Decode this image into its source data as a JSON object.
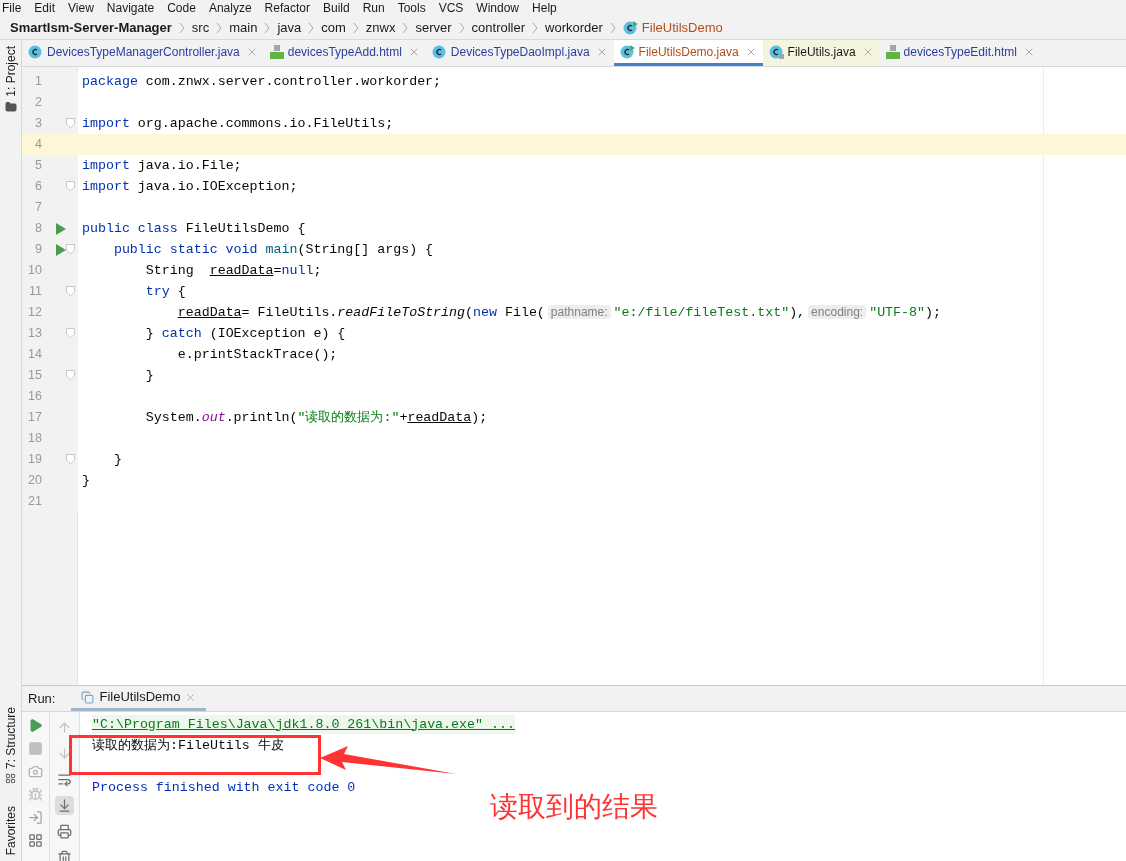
{
  "menu": [
    "File",
    "Edit",
    "View",
    "Navigate",
    "Code",
    "Analyze",
    "Refactor",
    "Build",
    "Run",
    "Tools",
    "VCS",
    "Window",
    "Help"
  ],
  "breadcrumbs": [
    {
      "label": "SmartIsm-Server-Manager",
      "kind": "project"
    },
    {
      "label": "src",
      "kind": "folder"
    },
    {
      "label": "main",
      "kind": "folder"
    },
    {
      "label": "java",
      "kind": "folder"
    },
    {
      "label": "com",
      "kind": "folder"
    },
    {
      "label": "znwx",
      "kind": "folder"
    },
    {
      "label": "server",
      "kind": "folder"
    },
    {
      "label": "controller",
      "kind": "folder"
    },
    {
      "label": "workorder",
      "kind": "folder"
    },
    {
      "label": "FileUtilsDemo",
      "kind": "class-run"
    }
  ],
  "side_tools": {
    "top": "1: Project",
    "bottom": [
      "7: Structure",
      "Favorites"
    ]
  },
  "tabs": [
    {
      "label": "DevicesTypeManagerController.java",
      "kind": "class",
      "selected": false
    },
    {
      "label": "devicesTypeAdd.html",
      "kind": "html",
      "selected": false
    },
    {
      "label": "DevicesTypeDaoImpl.java",
      "kind": "class",
      "selected": false
    },
    {
      "label": "FileUtilsDemo.java",
      "kind": "class-run",
      "selected": true
    },
    {
      "label": "FileUtils.java",
      "kind": "library",
      "selected": false
    },
    {
      "label": "devicesTypeEdit.html",
      "kind": "html",
      "selected": false
    }
  ],
  "code_lines": [
    {
      "number": "1",
      "run": false,
      "fold": false,
      "current": false,
      "tokens": [
        {
          "kind": "keyword",
          "text": "package"
        },
        {
          "kind": "plain",
          "text": " com.znwx.server.controller.workorder;"
        }
      ]
    },
    {
      "number": "2",
      "run": false,
      "fold": false,
      "current": false
    },
    {
      "number": "3",
      "run": false,
      "fold": true,
      "current": false,
      "tokens": [
        {
          "kind": "keyword",
          "text": "import"
        },
        {
          "kind": "plain",
          "text": " org.apache.commons.io.FileUtils;"
        }
      ]
    },
    {
      "number": "4",
      "run": false,
      "fold": false,
      "current": true
    },
    {
      "number": "5",
      "run": false,
      "fold": false,
      "current": false,
      "tokens": [
        {
          "kind": "keyword",
          "text": "import"
        },
        {
          "kind": "plain",
          "text": " java.io.File;"
        }
      ]
    },
    {
      "number": "6",
      "run": false,
      "fold": true,
      "current": false,
      "tokens": [
        {
          "kind": "keyword",
          "text": "import"
        },
        {
          "kind": "plain",
          "text": " java.io.IOException;"
        }
      ]
    },
    {
      "number": "7",
      "run": false,
      "fold": false,
      "current": false
    },
    {
      "number": "8",
      "run": true,
      "fold": false,
      "current": false,
      "tokens": [
        {
          "kind": "keyword",
          "text": "public class"
        },
        {
          "kind": "plain",
          "text": " FileUtilsDemo {"
        }
      ],
      "children": [
        {
          "number": "9",
          "run": true,
          "fold": true,
          "current": false,
          "tokens": [
            {
              "kind": "keyword",
              "text": "public static void"
            },
            {
              "kind": "method",
              "text": " main"
            },
            {
              "kind": "plain",
              "text": "(String[] args) {"
            }
          ],
          "children": [
            {
              "number": "10",
              "run": false,
              "fold": false,
              "current": false,
              "tokens": [
                {
                  "kind": "plain",
                  "text": "String  "
                },
                {
                  "kind": "variable",
                  "text": "readData"
                },
                {
                  "kind": "plain",
                  "text": "="
                },
                {
                  "kind": "keyword",
                  "text": "null"
                },
                {
                  "kind": "plain",
                  "text": ";"
                }
              ]
            },
            {
              "number": "11",
              "run": false,
              "fold": true,
              "current": false,
              "tokens": [
                {
                  "kind": "keyword",
                  "text": "try"
                },
                {
                  "kind": "plain",
                  "text": " {"
                }
              ],
              "children": [
                {
                  "number": "12",
                  "run": false,
                  "fold": false,
                  "current": false,
                  "tokens": [
                    {
                      "kind": "variable",
                      "text": "readData"
                    },
                    {
                      "kind": "plain",
                      "text": "= FileUtils."
                    },
                    {
                      "kind": "static-method",
                      "text": "readFileToString"
                    },
                    {
                      "kind": "plain",
                      "text": "("
                    },
                    {
                      "kind": "keyword",
                      "text": "new"
                    },
                    {
                      "kind": "plain",
                      "text": " File("
                    },
                    {
                      "kind": "hint",
                      "text": "pathname:"
                    },
                    {
                      "kind": "string",
                      "text": "\"e:/file/fileTest.txt\""
                    },
                    {
                      "kind": "plain",
                      "text": "),"
                    },
                    {
                      "kind": "hint",
                      "text": "encoding:"
                    },
                    {
                      "kind": "string",
                      "text": "\"UTF-8\""
                    },
                    {
                      "kind": "plain",
                      "text": ");"
                    }
                  ]
                }
              ]
            },
            {
              "number": "13",
              "run": false,
              "fold": true,
              "current": false,
              "tokens": [
                {
                  "kind": "plain",
                  "text": "} "
                },
                {
                  "kind": "keyword",
                  "text": "catch"
                },
                {
                  "kind": "plain",
                  "text": " (IOException e) {"
                }
              ],
              "children": [
                {
                  "number": "14",
                  "run": false,
                  "fold": false,
                  "current": false,
                  "tokens": [
                    {
                      "kind": "plain",
                      "text": "e.printStackTrace();"
                    }
                  ]
                }
              ]
            },
            {
              "number": "15",
              "run": false,
              "fold": true,
              "current": false,
              "tokens": [
                {
                  "kind": "plain",
                  "text": "}"
                }
              ]
            },
            {
              "number": "16",
              "run": false,
              "fold": false,
              "current": false
            },
            {
              "number": "17",
              "run": false,
              "fold": false,
              "current": false,
              "tokens": [
                {
                  "kind": "plain",
                  "text": "System."
                },
                {
                  "kind": "static-field",
                  "text": "out"
                },
                {
                  "kind": "plain",
                  "text": ".println("
                },
                {
                  "kind": "string",
                  "text": "\"读取的数据为:\""
                },
                {
                  "kind": "plain",
                  "text": "+"
                },
                {
                  "kind": "variable",
                  "text": "readData"
                },
                {
                  "kind": "plain",
                  "text": ");"
                }
              ]
            },
            {
              "number": "18",
              "run": false,
              "fold": false,
              "current": false
            }
          ]
        },
        {
          "number": "19",
          "run": false,
          "fold": true,
          "current": false,
          "tokens": [
            {
              "kind": "plain",
              "text": "}"
            }
          ]
        }
      ]
    },
    {
      "number": "20",
      "run": false,
      "fold": false,
      "current": false,
      "tokens": [
        {
          "kind": "plain",
          "text": "}"
        }
      ]
    },
    {
      "number": "21",
      "run": false,
      "fold": false,
      "current": false
    }
  ],
  "run_panel": {
    "label": "Run:",
    "tab": "FileUtilsDemo",
    "console": [
      {
        "kind": "command",
        "text": "\"C:\\Program Files\\Java\\jdk1.8.0_261\\bin\\java.exe\" ..."
      },
      {
        "kind": "output",
        "text": "读取的数据为:FileUtils 牛皮"
      },
      {
        "kind": "blank"
      },
      {
        "kind": "system",
        "text": "Process finished with exit code 0"
      }
    ]
  },
  "annotation": {
    "text": "读取到的结果"
  }
}
